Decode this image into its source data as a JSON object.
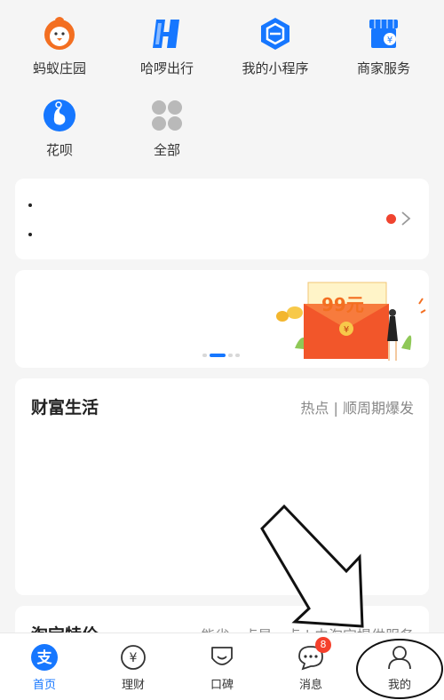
{
  "apps": [
    {
      "label": "蚂蚁庄园",
      "icon": "chick-icon"
    },
    {
      "label": "哈啰出行",
      "icon": "hello-bike-icon"
    },
    {
      "label": "我的小程序",
      "icon": "mini-program-icon"
    },
    {
      "label": "商家服务",
      "icon": "store-icon"
    },
    {
      "label": "花呗",
      "icon": "huabei-icon"
    },
    {
      "label": "全部",
      "icon": "all-apps-icon"
    }
  ],
  "promo": {
    "amount": "99元"
  },
  "wealth": {
    "title": "财富生活",
    "right": "热点 | 顺周期爆发"
  },
  "taobao": {
    "title": "淘宝特价",
    "right": "能省一点是一点 | 由淘宝提供服务"
  },
  "tabs": [
    {
      "label": "首页",
      "icon": "alipay-home-icon"
    },
    {
      "label": "理财",
      "icon": "yuan-icon"
    },
    {
      "label": "口碑",
      "icon": "koubei-icon"
    },
    {
      "label": "消息",
      "icon": "message-icon",
      "badge": "8"
    },
    {
      "label": "我的",
      "icon": "profile-icon"
    }
  ],
  "colors": {
    "accent": "#1677ff",
    "badge": "#f5402c",
    "orange": "#f36f21"
  }
}
